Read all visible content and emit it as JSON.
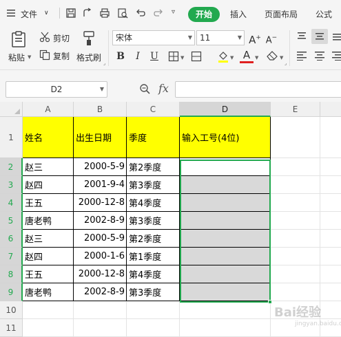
{
  "menu": {
    "file_label": "文件",
    "start_tab": "开始",
    "insert_tab": "插入",
    "page_layout_tab": "页面布局",
    "formula_tab": "公式"
  },
  "ribbon": {
    "paste_label": "粘贴",
    "cut_label": "剪切",
    "copy_label": "复制",
    "format_painter_label": "格式刷",
    "font_name": "宋体",
    "font_size": "11",
    "bold": "B",
    "italic": "I",
    "underline": "U",
    "font_color_glyph": "A",
    "increase_font": "A",
    "decrease_font": "A"
  },
  "formula_bar": {
    "cell_ref": "D2",
    "fx_label": "fx",
    "value": ""
  },
  "columns": [
    "A",
    "B",
    "C",
    "D",
    "E"
  ],
  "rows": [
    "1",
    "2",
    "3",
    "4",
    "5",
    "6",
    "7",
    "8",
    "9",
    "10",
    "11"
  ],
  "selected_column": "D",
  "table": {
    "headers": [
      "姓名",
      "出生日期",
      "季度",
      "输入工号(4位)"
    ],
    "rows": [
      [
        "赵三",
        "2000-5-9",
        "第2季度",
        ""
      ],
      [
        "赵四",
        "2001-9-4",
        "第3季度",
        ""
      ],
      [
        "王五",
        "2000-12-8",
        "第4季度",
        ""
      ],
      [
        "唐老鸭",
        "2002-8-9",
        "第3季度",
        ""
      ],
      [
        "赵三",
        "2000-5-9",
        "第2季度",
        ""
      ],
      [
        "赵四",
        "2000-1-6",
        "第1季度",
        ""
      ],
      [
        "王五",
        "2000-12-8",
        "第4季度",
        ""
      ],
      [
        "唐老鸭",
        "2002-8-9",
        "第3季度",
        ""
      ]
    ]
  },
  "watermark": {
    "text": "Bai经验",
    "sub": "jingyan.baidu.com"
  },
  "colors": {
    "accent": "#22a94f",
    "header_fill": "#ffff00",
    "selected_fill": "#d9d9d9"
  }
}
